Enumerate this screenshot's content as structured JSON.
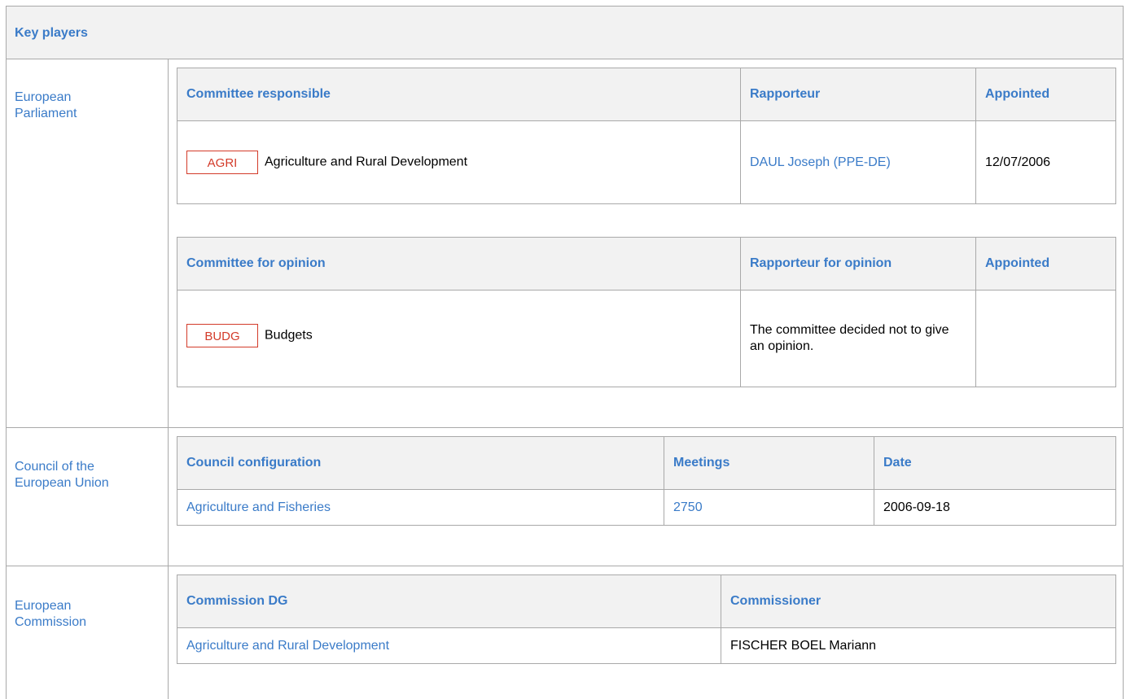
{
  "section": {
    "title": "Key players"
  },
  "parliament": {
    "label": "European Parliament",
    "responsible": {
      "headers": {
        "committee": "Committee responsible",
        "rapporteur": "Rapporteur",
        "appointed": "Appointed"
      },
      "row": {
        "code": "AGRI",
        "name": "Agriculture and Rural Development",
        "rapporteur": "DAUL Joseph (PPE-DE)",
        "appointed": "12/07/2006"
      }
    },
    "opinion": {
      "headers": {
        "committee": "Committee for opinion",
        "rapporteur": "Rapporteur for opinion",
        "appointed": "Appointed"
      },
      "row": {
        "code": "BUDG",
        "name": "Budgets",
        "rapporteur": "The committee decided not to give an opinion.",
        "appointed": ""
      }
    }
  },
  "council": {
    "label": "Council of the European Union",
    "headers": {
      "configuration": "Council configuration",
      "meetings": "Meetings",
      "date": "Date"
    },
    "row": {
      "configuration": "Agriculture and Fisheries",
      "meetings": "2750",
      "date": "2006-09-18"
    }
  },
  "commission": {
    "label": "European Commission",
    "headers": {
      "dg": "Commission DG",
      "commissioner": "Commissioner"
    },
    "row": {
      "dg": "Agriculture and Rural Development",
      "commissioner": "FISCHER BOEL Mariann"
    }
  },
  "colors": {
    "link": "#3a7bc8",
    "badge": "#d33b2a",
    "header_bg": "#f2f2f2",
    "border": "#a9a9a9"
  }
}
